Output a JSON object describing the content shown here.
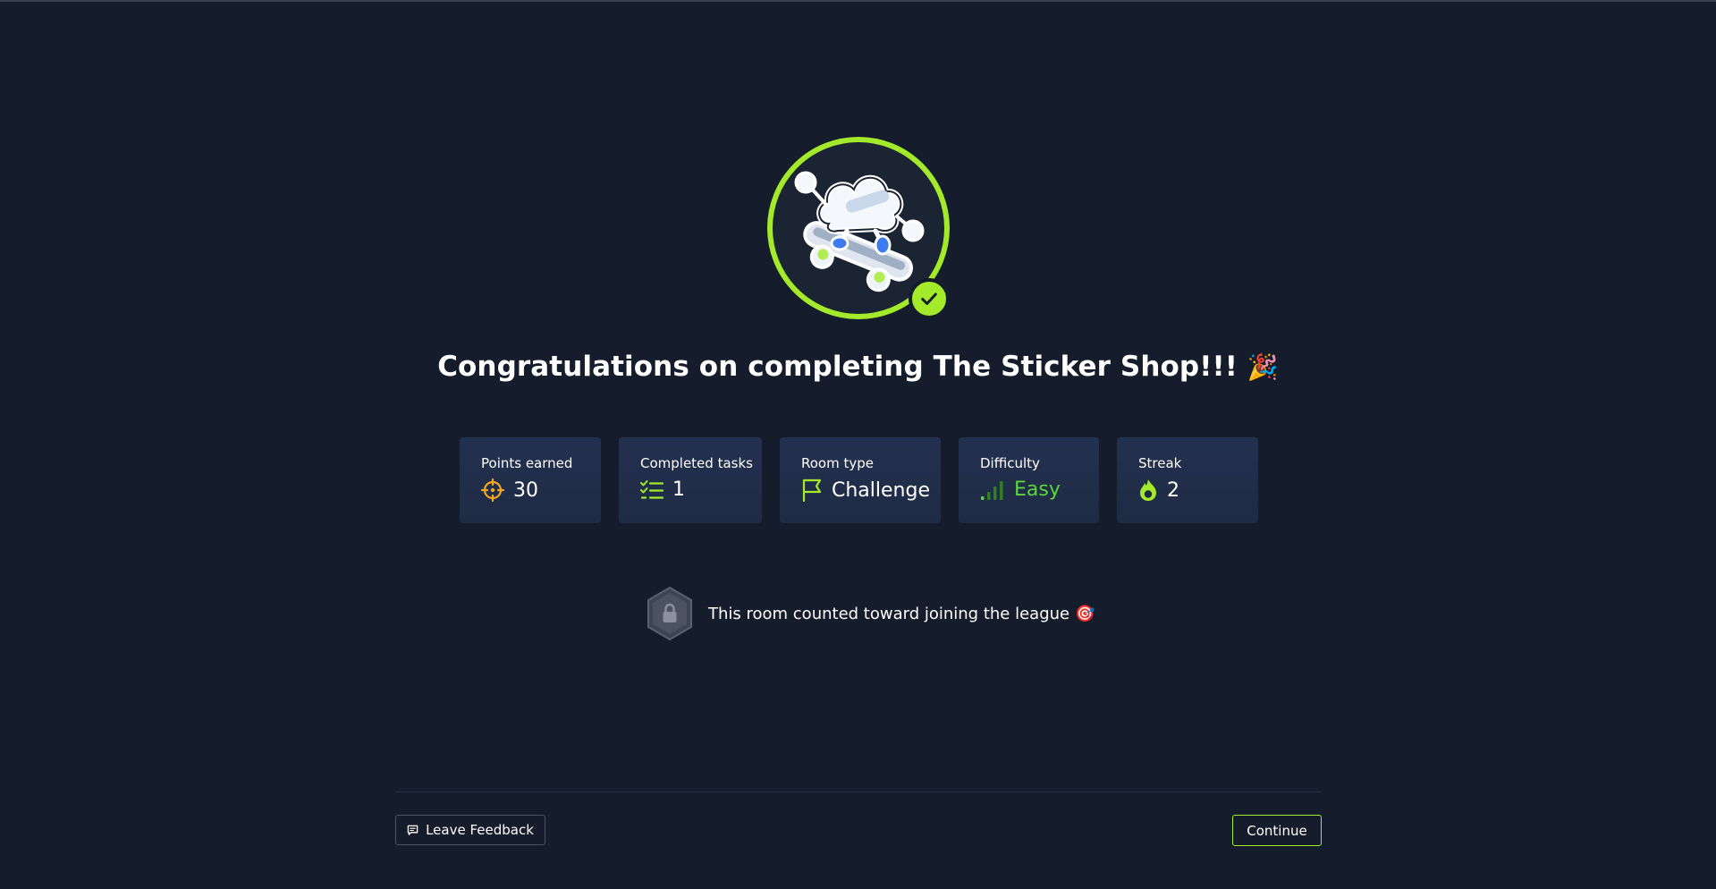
{
  "completion": {
    "title": "Congratulations on completing The Sticker Shop!!!",
    "title_emoji": "🎉",
    "avatar_icon": "cloud-skateboard-mascot",
    "badge_icon": "check-icon"
  },
  "stats": [
    {
      "label": "Points earned",
      "value": "30",
      "icon": "crosshair-icon",
      "color": "#f6a623"
    },
    {
      "label": "Completed tasks",
      "value": "1",
      "icon": "checklist-icon",
      "color": "#a3ea2a"
    },
    {
      "label": "Room type",
      "value": "Challenge",
      "icon": "flag-icon",
      "color": "#a3ea2a"
    },
    {
      "label": "Difficulty",
      "value": "Easy",
      "icon": "signal-bars-icon",
      "color": "#5cd63a"
    },
    {
      "label": "Streak",
      "value": "2",
      "icon": "flame-icon",
      "color": "#a3ea2a"
    }
  ],
  "league": {
    "text": "This room counted toward joining the league",
    "emoji": "🎯",
    "icon": "lock-hexagon-icon"
  },
  "footer": {
    "feedback_label": "Leave Feedback",
    "continue_label": "Continue"
  },
  "colors": {
    "background": "#151c2b",
    "accent": "#a3ea2a",
    "card": "#233150"
  }
}
